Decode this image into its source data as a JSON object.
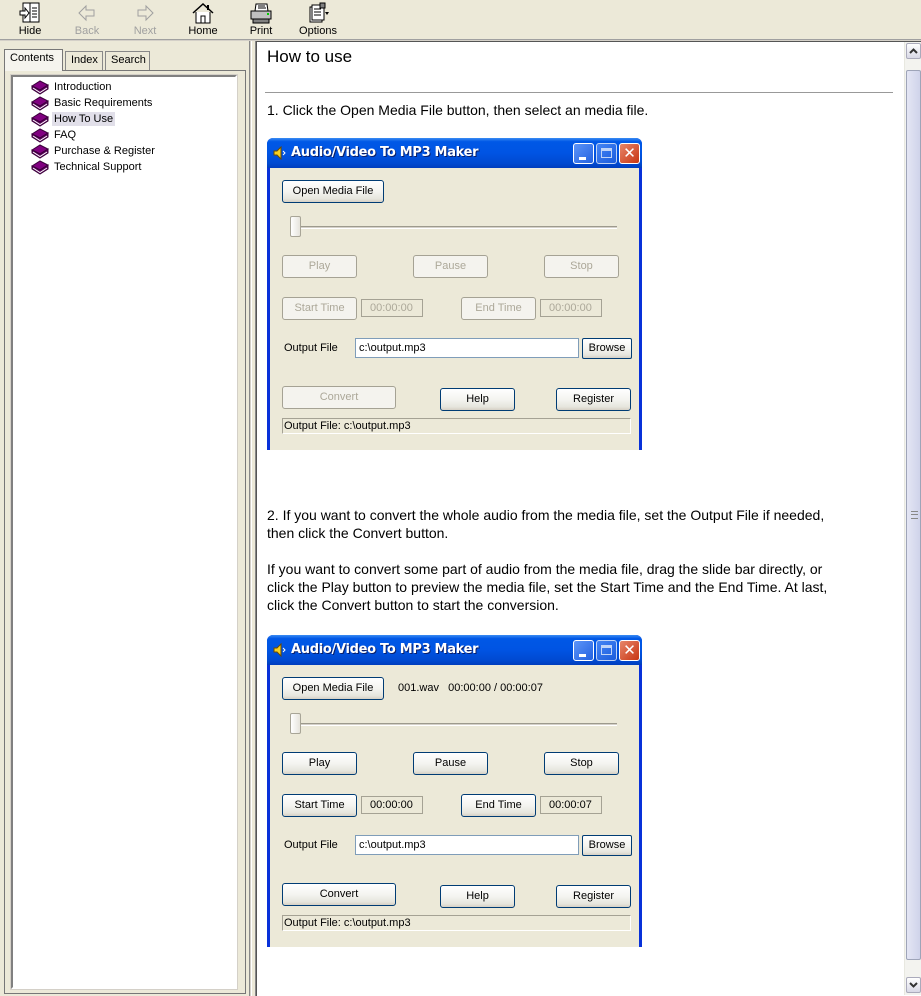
{
  "toolbar": {
    "buttons": [
      {
        "id": "hide",
        "label": "Hide",
        "icon": "hide-pane-icon",
        "enabled": true
      },
      {
        "id": "back",
        "label": "Back",
        "icon": "back-arrow-icon",
        "enabled": false
      },
      {
        "id": "next",
        "label": "Next",
        "icon": "next-arrow-icon",
        "enabled": false
      },
      {
        "id": "home",
        "label": "Home",
        "icon": "home-icon",
        "enabled": true
      },
      {
        "id": "print",
        "label": "Print",
        "icon": "printer-icon",
        "enabled": true
      },
      {
        "id": "options",
        "label": "Options",
        "icon": "options-icon",
        "enabled": true
      }
    ]
  },
  "nav": {
    "tabs": [
      {
        "label": "Contents",
        "active": true
      },
      {
        "label": "Index",
        "active": false
      },
      {
        "label": "Search",
        "active": false
      }
    ],
    "tree": [
      {
        "label": "Introduction",
        "icon": "book-icon",
        "selected": false
      },
      {
        "label": "Basic Requirements",
        "icon": "book-icon",
        "selected": false
      },
      {
        "label": "How To Use",
        "icon": "book-icon",
        "selected": true
      },
      {
        "label": "FAQ",
        "icon": "book-icon",
        "selected": false
      },
      {
        "label": "Purchase & Register",
        "icon": "book-icon",
        "selected": false
      },
      {
        "label": "Technical Support",
        "icon": "book-icon",
        "selected": false
      }
    ],
    "colors": {
      "book": "#800080",
      "selection": "#e1dfe9"
    }
  },
  "content": {
    "title": "How to use",
    "step1": "1. Click the Open Media File button, then select an media file.",
    "step2_line1": "2. If you want to convert the whole audio from the media file, set the Output File if needed,",
    "step2_line2": "then click the Convert button.",
    "step2b_line1": "If you want to convert some part of audio from the media file, drag the slide bar directly, or",
    "step2b_line2": "click the Play button to preview the media file, set the Start Time and the End Time. At last,",
    "step2b_line3": "click the Convert button to start the conversion.",
    "scroll_position": 0
  },
  "app_windows": [
    {
      "title": "Audio/Video To MP3 Maker",
      "open_button": "Open Media File",
      "file_info": "",
      "slider_value": 0,
      "play": "Play",
      "pause": "Pause",
      "stop": "Stop",
      "start_time_button": "Start Time",
      "start_time": "00:00:00",
      "end_time_button": "End Time",
      "end_time": "00:00:00",
      "output_label": "Output File",
      "output_value": "c:\\output.mp3",
      "browse": "Browse",
      "convert": "Convert",
      "help": "Help",
      "register": "Register",
      "status": "Output File: c:\\output.mp3",
      "media_loaded": false
    },
    {
      "title": "Audio/Video To MP3 Maker",
      "open_button": "Open Media File",
      "file_info": "001.wav   00:00:00 / 00:00:07",
      "slider_value": 0,
      "play": "Play",
      "pause": "Pause",
      "stop": "Stop",
      "start_time_button": "Start Time",
      "start_time": "00:00:00",
      "end_time_button": "End Time",
      "end_time": "00:00:07",
      "output_label": "Output File",
      "output_value": "c:\\output.mp3",
      "browse": "Browse",
      "convert": "Convert",
      "help": "Help",
      "register": "Register",
      "status": "Output File: c:\\output.mp3",
      "media_loaded": true
    }
  ]
}
